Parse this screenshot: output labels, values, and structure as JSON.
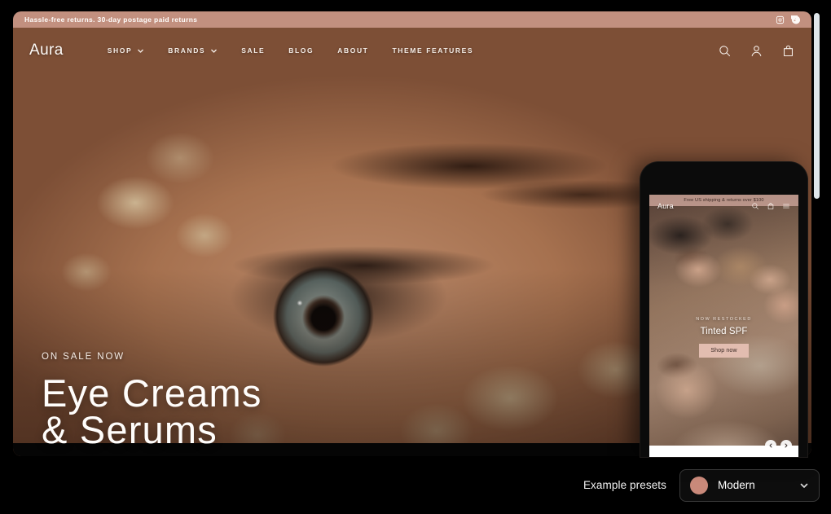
{
  "desktop_preview": {
    "announcement": {
      "text": "Hassle-free returns. 30-day postage paid returns",
      "social": [
        {
          "name": "instagram-icon",
          "label": "Instagram"
        },
        {
          "name": "facebook-icon",
          "label": "Facebook"
        }
      ]
    },
    "header": {
      "logo": "Aura",
      "nav": [
        {
          "label": "SHOP",
          "has_dropdown": true
        },
        {
          "label": "BRANDS",
          "has_dropdown": true
        },
        {
          "label": "SALE",
          "has_dropdown": false
        },
        {
          "label": "BLOG",
          "has_dropdown": false
        },
        {
          "label": "ABOUT",
          "has_dropdown": false
        },
        {
          "label": "THEME FEATURES",
          "has_dropdown": false
        }
      ],
      "actions": [
        {
          "name": "search-icon",
          "label": "Search"
        },
        {
          "name": "account-icon",
          "label": "Account"
        },
        {
          "name": "cart-icon",
          "label": "Cart"
        }
      ]
    },
    "hero": {
      "eyebrow": "ON SALE NOW",
      "title_line1": "Eye Creams",
      "title_line2": "& Serums"
    }
  },
  "mobile_preview": {
    "announcement": "Free US shipping & returns over $100",
    "logo": "Aura",
    "actions": [
      {
        "name": "search-icon",
        "label": "Search"
      },
      {
        "name": "cart-icon",
        "label": "Cart"
      },
      {
        "name": "menu-icon",
        "label": "Menu"
      }
    ],
    "overlay": {
      "eyebrow": "NOW RESTOCKED",
      "title": "Tinted SPF",
      "button": "Shop now"
    },
    "carousel": {
      "prev": "‹",
      "next": "›"
    }
  },
  "bottom_bar": {
    "label": "Example presets",
    "selected_preset": "Modern",
    "swatch_color": "#c9897a"
  }
}
